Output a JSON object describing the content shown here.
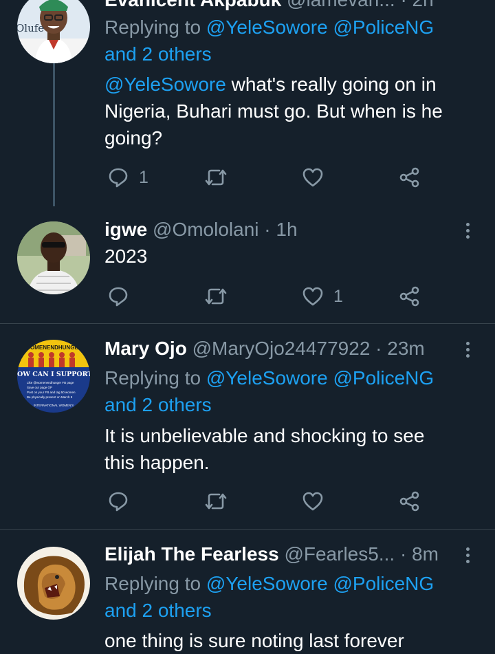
{
  "colors": {
    "background": "#15202b",
    "divider": "#38444d",
    "secondary_text": "#8899a6",
    "link": "#1da1f2",
    "primary_text": "#ffffff"
  },
  "tweets": [
    {
      "name": "Evanicent Akpabuk",
      "handle": "@iamevan...",
      "time": "2h",
      "avatar_label": "Olufe",
      "replying_prefix": "Replying to",
      "replying_mentions": "@YeleSowore @PoliceNG",
      "replying_others": "and 2 others",
      "body_mention": "@YeleSowore",
      "body_line1_rest": " what's really going on in",
      "body_line2": "Nigeria, Buhari must go. But when is he",
      "body_line3": "going?",
      "reply_count": "1",
      "like_count": ""
    },
    {
      "name": "igwe",
      "handle": "@Omololani",
      "time": "1h",
      "body_line1": "2023",
      "reply_count": "",
      "like_count": "1"
    },
    {
      "name": "Mary Ojo",
      "handle": "@MaryOjo24477922",
      "time": "23m",
      "avatar_banner": "WOMENENDHUNGER",
      "avatar_title": "HOW CAN I SUPPORT?",
      "avatar_item1": "Like @womenendhunger FB page",
      "avatar_item2": "Save our page OP",
      "avatar_item3": "Post on your FB and tag 50 women",
      "avatar_item4": "Be physically present on March 8",
      "avatar_footer": "INTERNATIONAL WOMEN'S",
      "replying_prefix": "Replying to",
      "replying_mentions": "@YeleSowore @PoliceNG",
      "replying_others": "and 2 others",
      "body_line1": "It is unbelievable and shocking to see",
      "body_line2": "this happen.",
      "reply_count": "",
      "like_count": ""
    },
    {
      "name": "Elijah The Fearless",
      "handle": "@Fearles5...",
      "time": "8m",
      "replying_prefix": "Replying to",
      "replying_mentions": "@YeleSowore @PoliceNG",
      "replying_others": "and 2 others",
      "body_line1": "one thing is sure noting last forever"
    }
  ],
  "icons": [
    "reply-icon",
    "retweet-icon",
    "like-icon",
    "share-icon",
    "more-icon"
  ]
}
